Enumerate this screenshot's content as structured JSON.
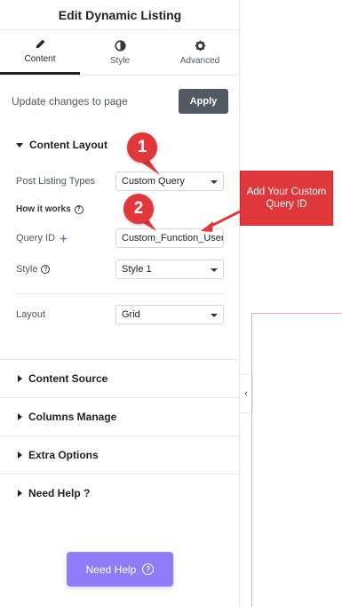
{
  "panel": {
    "title": "Edit Dynamic Listing",
    "tabs": [
      {
        "label": "Content",
        "icon": "pencil-icon",
        "active": true
      },
      {
        "label": "Style",
        "icon": "contrast-icon",
        "active": false
      },
      {
        "label": "Advanced",
        "icon": "gear-icon",
        "active": false
      }
    ],
    "update_text": "Update changes to page",
    "apply_label": "Apply"
  },
  "content_layout": {
    "title": "Content Layout",
    "post_listing_types_label": "Post Listing Types",
    "post_listing_types_value": "Custom Query",
    "how_it_works_label": "How it works",
    "query_id_label": "Query ID",
    "query_id_value": "Custom_Function_User",
    "style_label": "Style",
    "style_value": "Style 1",
    "layout_label": "Layout",
    "layout_value": "Grid"
  },
  "sections": [
    {
      "title": "Content Source"
    },
    {
      "title": "Columns Manage"
    },
    {
      "title": "Extra Options"
    },
    {
      "title": "Need Help ?"
    }
  ],
  "need_help_button": "Need Help",
  "annotations": {
    "marker_1": "1",
    "marker_2": "2",
    "callout": "Add Your Custom Query ID",
    "color": "#e0373a"
  },
  "colors": {
    "accent_purple": "#8f7cf9",
    "apply_button": "#515962"
  }
}
